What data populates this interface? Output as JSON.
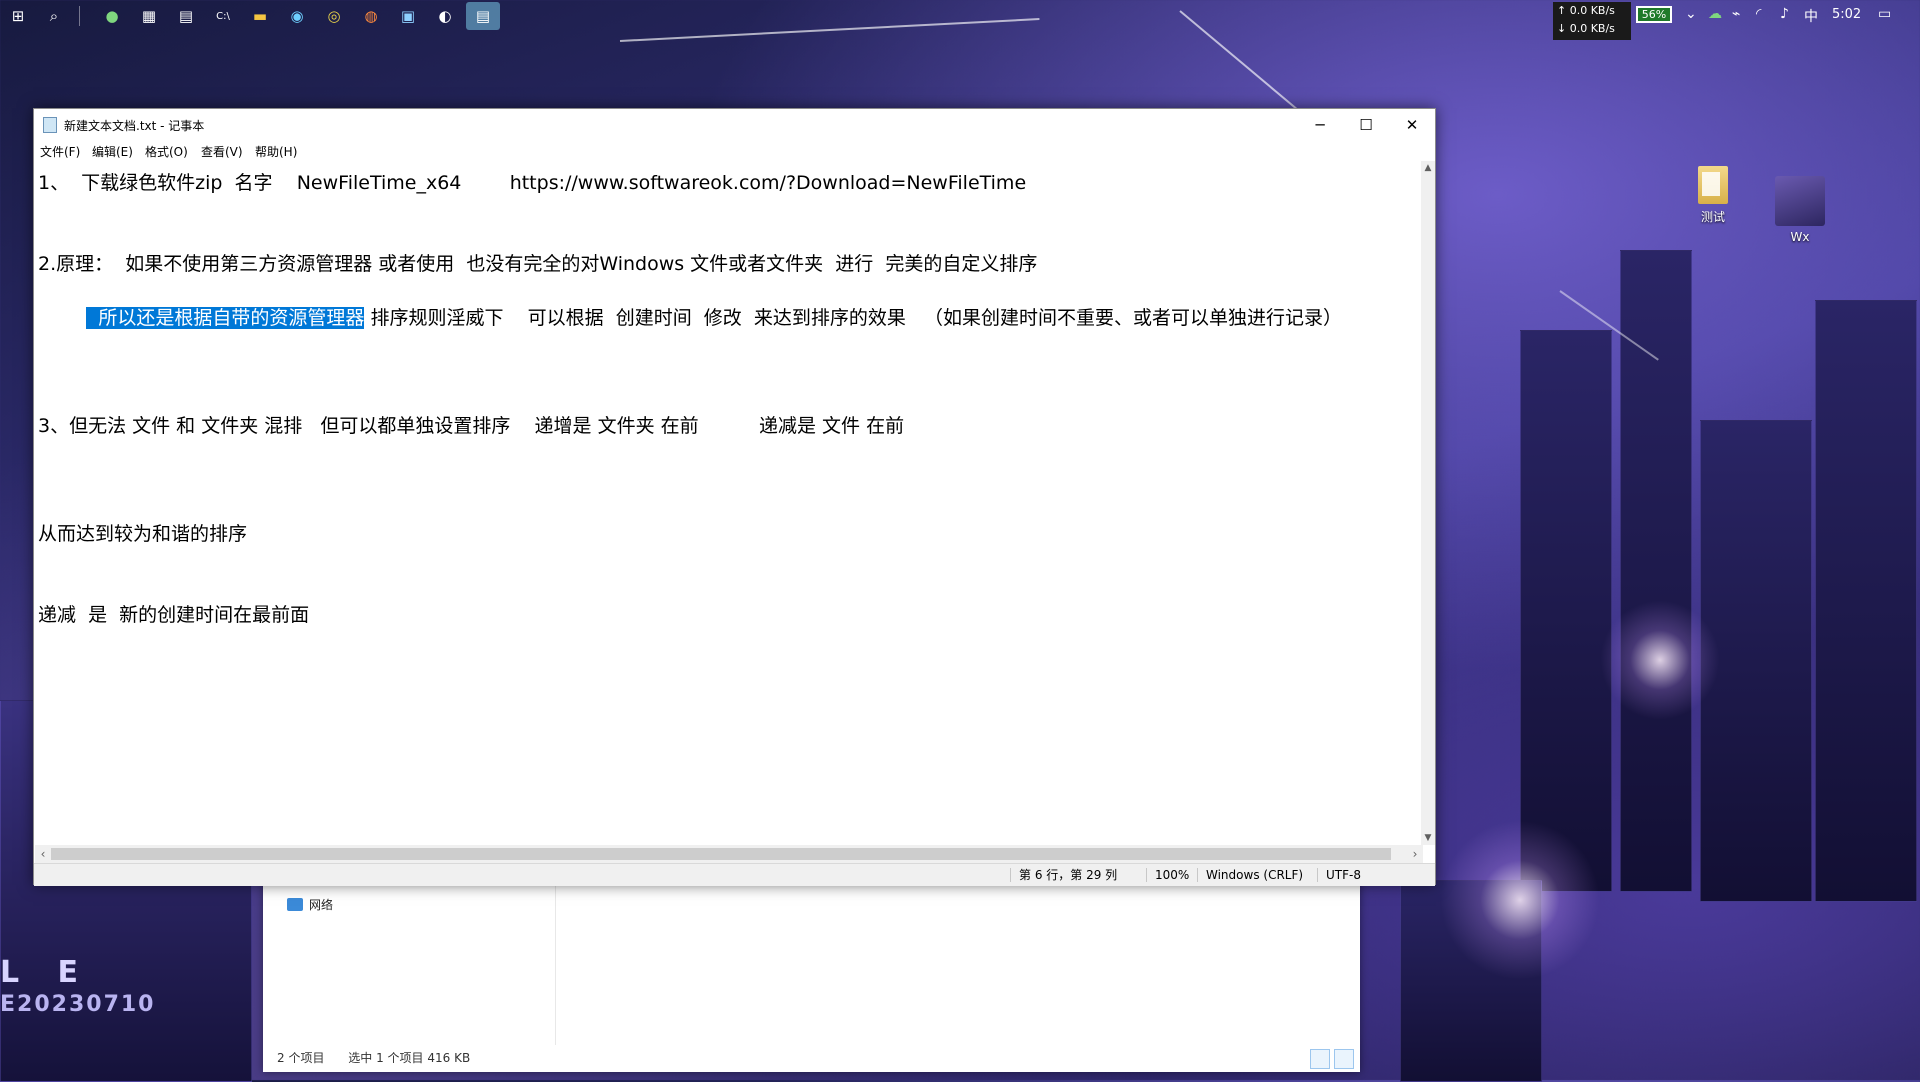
{
  "taskbar": {
    "icons": [
      "windows-start-icon",
      "search-icon",
      "wechat-icon",
      "calculator-icon",
      "photos-icon",
      "terminal-icon",
      "file-explorer-icon",
      "qq-icon",
      "chrome-icon",
      "firefox-icon",
      "app-icon",
      "media-icon",
      "notepad-icon"
    ],
    "net_up": "↑ 0.0 KB/s",
    "net_down": "↓ 0.0 KB/s",
    "battery": "56%",
    "ime": "中",
    "clock": "5:02"
  },
  "desktop": {
    "icons": [
      {
        "label": "测试",
        "icon": "folder-icon"
      },
      {
        "label": "Wx",
        "icon": "avatar-icon"
      }
    ],
    "wallpaper_text_1": "L E",
    "wallpaper_text_2": "E20230710"
  },
  "explorer": {
    "nav_item": "网络",
    "status_items": "2 个项目",
    "status_selected": "选中 1 个项目  416 KB"
  },
  "notepad": {
    "title": "新建文本文档.txt - 记事本",
    "menu": [
      "文件(F)",
      "编辑(E)",
      "格式(O)",
      "查看(V)",
      "帮助(H)"
    ],
    "lines": {
      "l1": "1、  下载绿色软件zip  名字    NewFileTime_x64        https://www.softwareok.com/?Download=NewFileTime",
      "l2": "2.原理：  如果不使用第三方资源管理器 或者使用  也没有完全的对Windows 文件或者文件夹  进行  完美的自定义排序",
      "l3_indent": "        ",
      "l3_selected": "  所以还是根据自带的资源管理器",
      "l3_rest": " 排序规则淫威下    可以根据  创建时间  修改  来达到排序的效果   （如果创建时间不重要、或者可以单独进行记录）",
      "l4": "3、但无法 文件 和 文件夹 混排   但可以都单独设置排序    递增是 文件夹 在前          递减是 文件 在前",
      "l5": "从而达到较为和谐的排序",
      "l6": "递减  是  新的创建时间在最前面"
    },
    "status": {
      "position": "第 6 行，第 29 列",
      "zoom": "100%",
      "line_ending": "Windows (CRLF)",
      "encoding": "UTF-8"
    }
  },
  "colors": {
    "selection": "#0078d7",
    "battery": "#1f7a2a"
  }
}
